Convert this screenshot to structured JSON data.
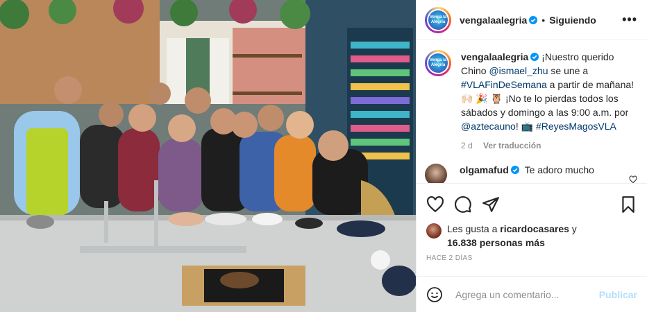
{
  "post": {
    "account": "vengalaalegria",
    "avatar_label": "Venga la Alegría",
    "follow_status": "Siguiendo",
    "more_label": "•••",
    "photo_alt": "Elenco de Venga la Alegría en la cocina del programa"
  },
  "caption": {
    "username": "vengalaalegria",
    "t1": "¡Nuestro querido Chino ",
    "mention1": "@ismael_zhu",
    "t2": " se une a ",
    "hashtag1": "#VLAFinDeSemana",
    "t3": " a partir de mañana! 🙌🏻 🎉 🦉 ¡No te lo pierdas todos los sábados y domingo a las 9:00 a.m. por ",
    "mention2": "@aztecauno",
    "t4": "! 📺 ",
    "hashtag2": "#ReyesMagosVLA",
    "age": "2 d",
    "translate": "Ver traducción"
  },
  "comment": {
    "username": "olgamafud",
    "text": "Te adoro mucho"
  },
  "likes": {
    "prefix": "Les gusta a ",
    "user": "ricardocasares",
    "mid": " y",
    "count": "16.838 personas más"
  },
  "time_ago": "HACE 2 DÍAS",
  "composer": {
    "placeholder": "Agrega un comentario...",
    "publish": "Publicar"
  },
  "colors": {
    "verified": "#0095f6",
    "link": "#00376b",
    "publish_disabled": "#b2dffc",
    "muted": "#8e8e8e"
  }
}
